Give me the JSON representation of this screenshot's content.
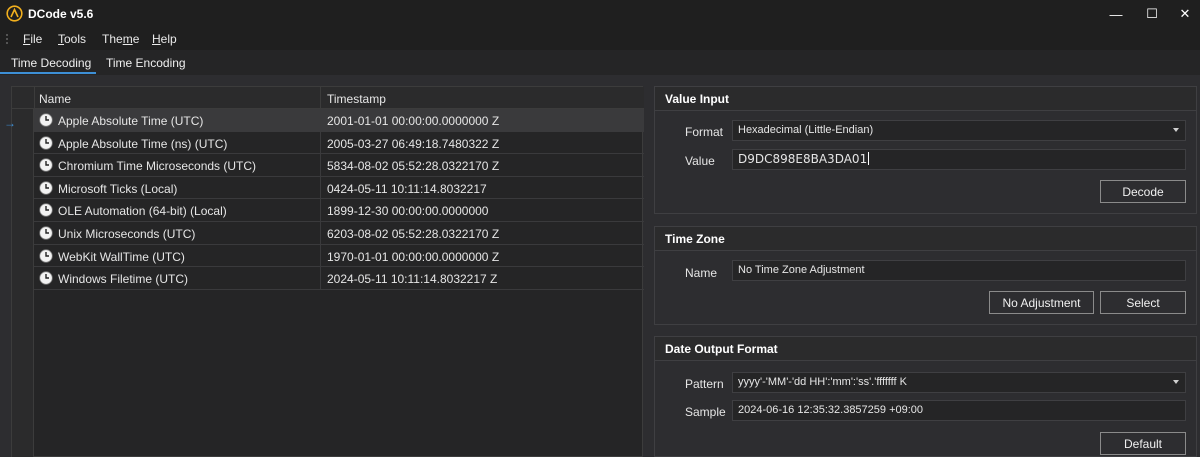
{
  "app": {
    "title": "DCode v5.6"
  },
  "window_controls": {
    "minimize": "—",
    "maximize": "☐",
    "close": "✕"
  },
  "menu": [
    {
      "hotkey": "F",
      "rest": "ile"
    },
    {
      "hotkey": "T",
      "rest": "ools"
    },
    {
      "prefix": "The",
      "hotkey": "m",
      "rest": "e"
    },
    {
      "hotkey": "H",
      "rest": "elp"
    }
  ],
  "tabs": [
    {
      "label": "Time Decoding",
      "active": true
    },
    {
      "label": "Time Encoding",
      "active": false
    }
  ],
  "grid": {
    "columns": [
      "Name",
      "Timestamp"
    ],
    "current_row_marker": "→",
    "rows": [
      {
        "icon": "clock-icon",
        "name": "Apple Absolute Time (UTC)",
        "timestamp": "2001-01-01 00:00:00.0000000 Z"
      },
      {
        "icon": "clock-icon",
        "name": "Apple Absolute Time (ns) (UTC)",
        "timestamp": "2005-03-27 06:49:18.7480322 Z"
      },
      {
        "icon": "clock-icon",
        "name": "Chromium Time Microseconds (UTC)",
        "timestamp": "5834-08-02 05:52:28.0322170 Z"
      },
      {
        "icon": "clock-icon",
        "name": "Microsoft Ticks (Local)",
        "timestamp": "0424-05-11 10:11:14.8032217"
      },
      {
        "icon": "clock-icon",
        "name": "OLE Automation (64-bit) (Local)",
        "timestamp": "1899-12-30 00:00:00.0000000"
      },
      {
        "icon": "clock-icon",
        "name": "Unix Microseconds (UTC)",
        "timestamp": "6203-08-02 05:52:28.0322170 Z"
      },
      {
        "icon": "clock-icon",
        "name": "WebKit WallTime (UTC)",
        "timestamp": "1970-01-01 00:00:00.0000000 Z"
      },
      {
        "icon": "clock-icon",
        "name": "Windows Filetime (UTC)",
        "timestamp": "2024-05-11 10:11:14.8032217 Z"
      }
    ]
  },
  "value_input": {
    "title": "Value Input",
    "format_label": "Format",
    "format_value": "Hexadecimal (Little-Endian)",
    "value_label": "Value",
    "value": "D9DC898E8BA3DA01",
    "decode_button": "Decode"
  },
  "time_zone": {
    "title": "Time Zone",
    "name_label": "Name",
    "name_value": "No Time Zone Adjustment",
    "no_adjustment_button": "No Adjustment",
    "select_button": "Select"
  },
  "date_output": {
    "title": "Date Output Format",
    "pattern_label": "Pattern",
    "pattern_value": "yyyy'-'MM'-'dd HH':'mm':'ss'.'fffffff K",
    "sample_label": "Sample",
    "sample_value": "2024-06-16 12:35:32.3857259 +09:00",
    "default_button": "Default"
  },
  "colors": {
    "accent": "#3d8fd6",
    "background": "#2d2d30",
    "titlebar": "#1f1f1f",
    "selected_row": "#3a3a3c"
  }
}
